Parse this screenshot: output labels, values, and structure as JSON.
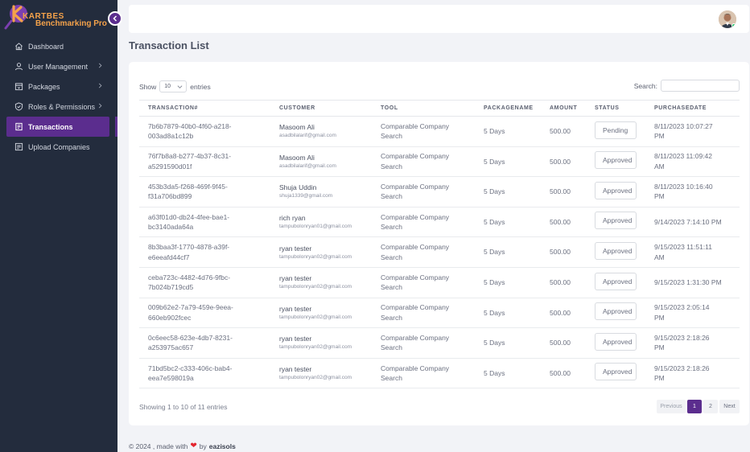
{
  "brand": {
    "line1": "KARTBES",
    "line2": "Benchmarking Pro"
  },
  "sidebar": {
    "items": [
      {
        "label": "Dashboard",
        "icon": "home-icon"
      },
      {
        "label": "User Management",
        "icon": "user-icon"
      },
      {
        "label": "Packages",
        "icon": "package-icon"
      },
      {
        "label": "Roles & Permissions",
        "icon": "shield-icon"
      },
      {
        "label": "Transactions",
        "icon": "document-icon"
      },
      {
        "label": "Upload Companies",
        "icon": "upload-icon"
      }
    ]
  },
  "page": {
    "title": "Transaction List"
  },
  "table_controls": {
    "show": "Show",
    "length": "10",
    "entries": "entries",
    "search_label": "Search:"
  },
  "columns": [
    "TRANSACTION#",
    "CUSTOMER",
    "TOOL",
    "PACKAGENAME",
    "AMOUNT",
    "STATUS",
    "PURCHASEDATE"
  ],
  "rows": [
    {
      "id1": "7b6b7879-40b0-4f60-a218-",
      "id2": "003ad8a1c12b",
      "name": "Masoom Ali",
      "email": "asadbilalarif@gmail.com",
      "tool1": "Comparable Company",
      "tool2": "Search",
      "package": "5 Days",
      "amount": "500.00",
      "status": "Pending",
      "date1": "8/11/2023 10:07:27",
      "date2": "PM"
    },
    {
      "id1": "76f7b8a8-b277-4b37-8c31-",
      "id2": "a5291590d01f",
      "name": "Masoom Ali",
      "email": "asadbilalarif@gmail.com",
      "tool1": "Comparable Company",
      "tool2": "Search",
      "package": "5 Days",
      "amount": "500.00",
      "status": "Approved",
      "date1": "8/11/2023 11:09:42",
      "date2": "AM"
    },
    {
      "id1": "453b3da5-f268-469f-9f45-",
      "id2": "f31a706bd899",
      "name": "Shuja Uddin",
      "email": "shuja1339@gmail.com",
      "tool1": "Comparable Company",
      "tool2": "Search",
      "package": "5 Days",
      "amount": "500.00",
      "status": "Approved",
      "date1": "8/11/2023 10:16:40",
      "date2": "PM"
    },
    {
      "id1": "a63f01d0-db24-4fee-bae1-",
      "id2": "bc3140ada64a",
      "name": "rich ryan",
      "email": "tampubolonryan01@gmail.com",
      "tool1": "Comparable Company",
      "tool2": "Search",
      "package": "5 Days",
      "amount": "500.00",
      "status": "Approved",
      "date1": "9/14/2023 7:14:10 PM",
      "date2": ""
    },
    {
      "id1": "8b3baa3f-1770-4878-a39f-",
      "id2": "e6eeafd44cf7",
      "name": "ryan tester",
      "email": "tampubolonryan02@gmail.com",
      "tool1": "Comparable Company",
      "tool2": "Search",
      "package": "5 Days",
      "amount": "500.00",
      "status": "Approved",
      "date1": "9/15/2023 11:51:11",
      "date2": "AM"
    },
    {
      "id1": "ceba723c-4482-4d76-9fbc-",
      "id2": "7b024b719cd5",
      "name": "ryan tester",
      "email": "tampubolonryan02@gmail.com",
      "tool1": "Comparable Company",
      "tool2": "Search",
      "package": "5 Days",
      "amount": "500.00",
      "status": "Approved",
      "date1": "9/15/2023 1:31:30 PM",
      "date2": ""
    },
    {
      "id1": "009b62e2-7a79-459e-9eea-",
      "id2": "660eb902fcec",
      "name": "ryan tester",
      "email": "tampubolonryan02@gmail.com",
      "tool1": "Comparable Company",
      "tool2": "Search",
      "package": "5 Days",
      "amount": "500.00",
      "status": "Approved",
      "date1": "9/15/2023 2:05:14",
      "date2": "PM"
    },
    {
      "id1": "0c6eec58-623e-4db7-8231-",
      "id2": "a253975ac657",
      "name": "ryan tester",
      "email": "tampubolonryan02@gmail.com",
      "tool1": "Comparable Company",
      "tool2": "Search",
      "package": "5 Days",
      "amount": "500.00",
      "status": "Approved",
      "date1": "9/15/2023 2:18:26",
      "date2": "PM"
    },
    {
      "id1": "71bd5bc2-c333-406c-bab4-",
      "id2": "eea7e598019a",
      "name": "ryan tester",
      "email": "tampubolonryan02@gmail.com",
      "tool1": "Comparable Company",
      "tool2": "Search",
      "package": "5 Days",
      "amount": "500.00",
      "status": "Approved",
      "date1": "9/15/2023 2:18:26",
      "date2": "PM"
    }
  ],
  "table_info": "Showing 1 to 10 of 11 entries",
  "pagination": {
    "previous": "Previous",
    "pages": [
      "1",
      "2"
    ],
    "next": "Next"
  },
  "footer": {
    "prefix": "© 2024 , made with",
    "by": "by",
    "brand": "eazisols"
  },
  "colors": {
    "sidebar": "#232c3d",
    "accent": "#5b2d8e",
    "logo": "#f4a24a"
  }
}
